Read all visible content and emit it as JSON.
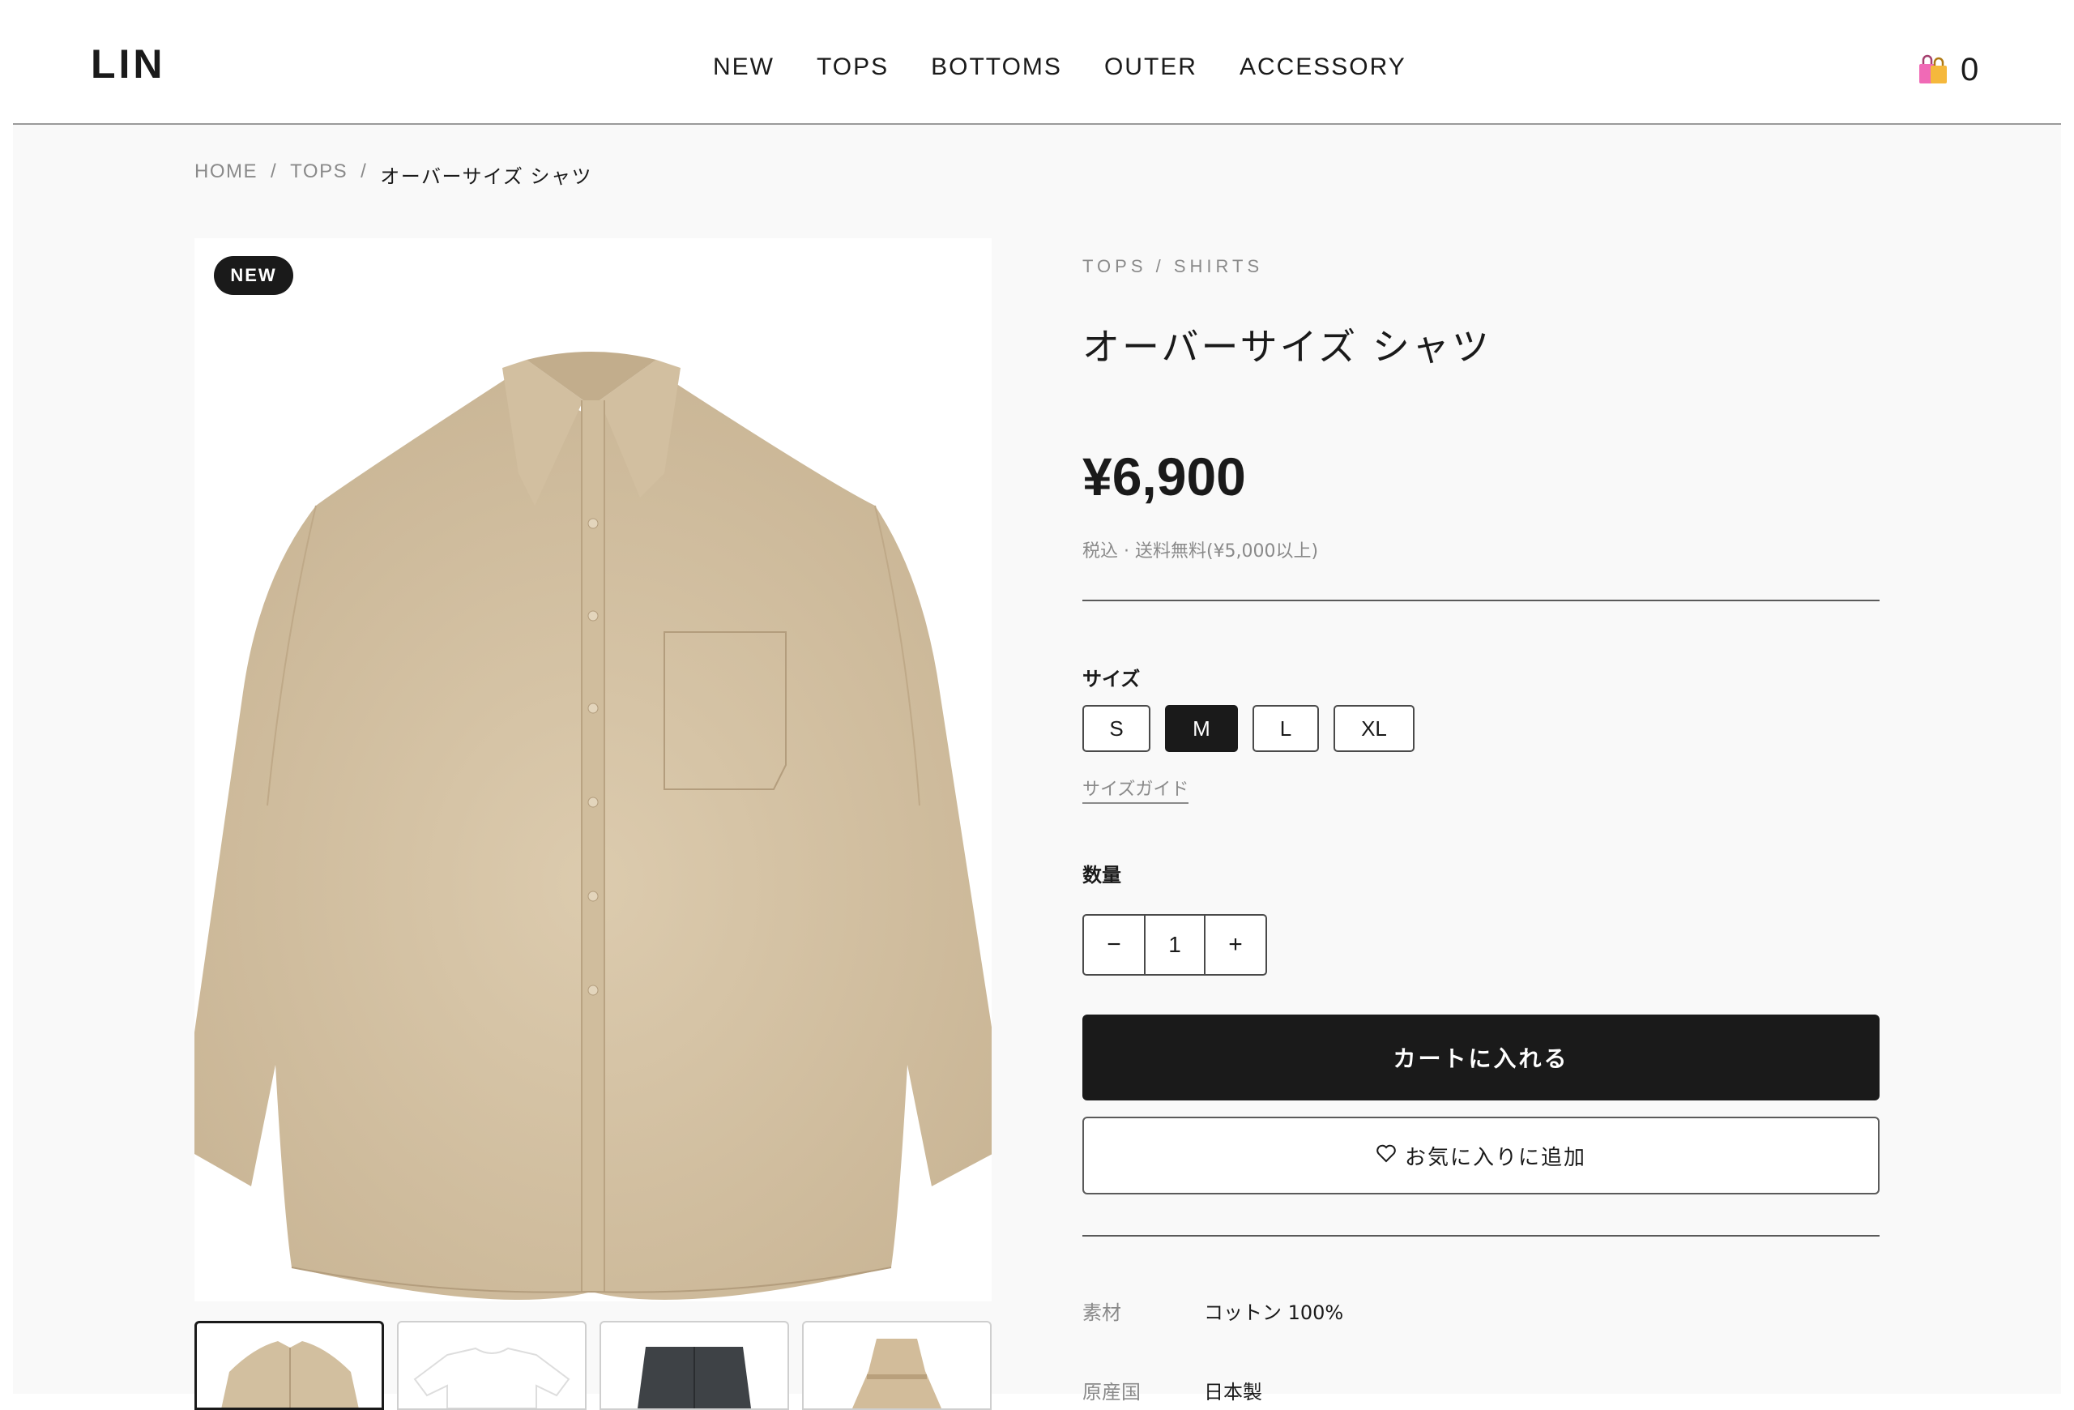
{
  "header": {
    "logo": "LIN",
    "nav": [
      "NEW",
      "TOPS",
      "BOTTOMS",
      "OUTER",
      "ACCESSORY"
    ],
    "cart_count": "0",
    "cart_icon": "shopping-bags-icon"
  },
  "breadcrumb": {
    "items": [
      "HOME",
      "TOPS",
      "オーバーサイズ シャツ"
    ],
    "separator": "/"
  },
  "product": {
    "badge": "NEW",
    "category": "TOPS / SHIRTS",
    "title": "オーバーサイズ シャツ",
    "price": "¥6,900",
    "tax_note": "税込 · 送料無料(¥5,000以上)",
    "size_label": "サイズ",
    "sizes": [
      "S",
      "M",
      "L",
      "XL"
    ],
    "selected_size": "M",
    "size_guide": "サイズガイド",
    "quantity_label": "数量",
    "quantity": "1",
    "minus": "−",
    "plus": "+",
    "add_to_cart": "カートに入れる",
    "favorite": "お気に入りに追加",
    "specs": [
      {
        "key": "素材",
        "value": "コットン 100%"
      },
      {
        "key": "原産国",
        "value": "日本製"
      }
    ]
  },
  "thumbnails": [
    "beige-shirt",
    "white-tshirt",
    "charcoal-pants",
    "beige-dress"
  ],
  "colors": {
    "accent": "#1a1a1a",
    "muted": "#8a8a8a",
    "shirt": "#d8c6a8",
    "background": "#f9f9f9"
  }
}
